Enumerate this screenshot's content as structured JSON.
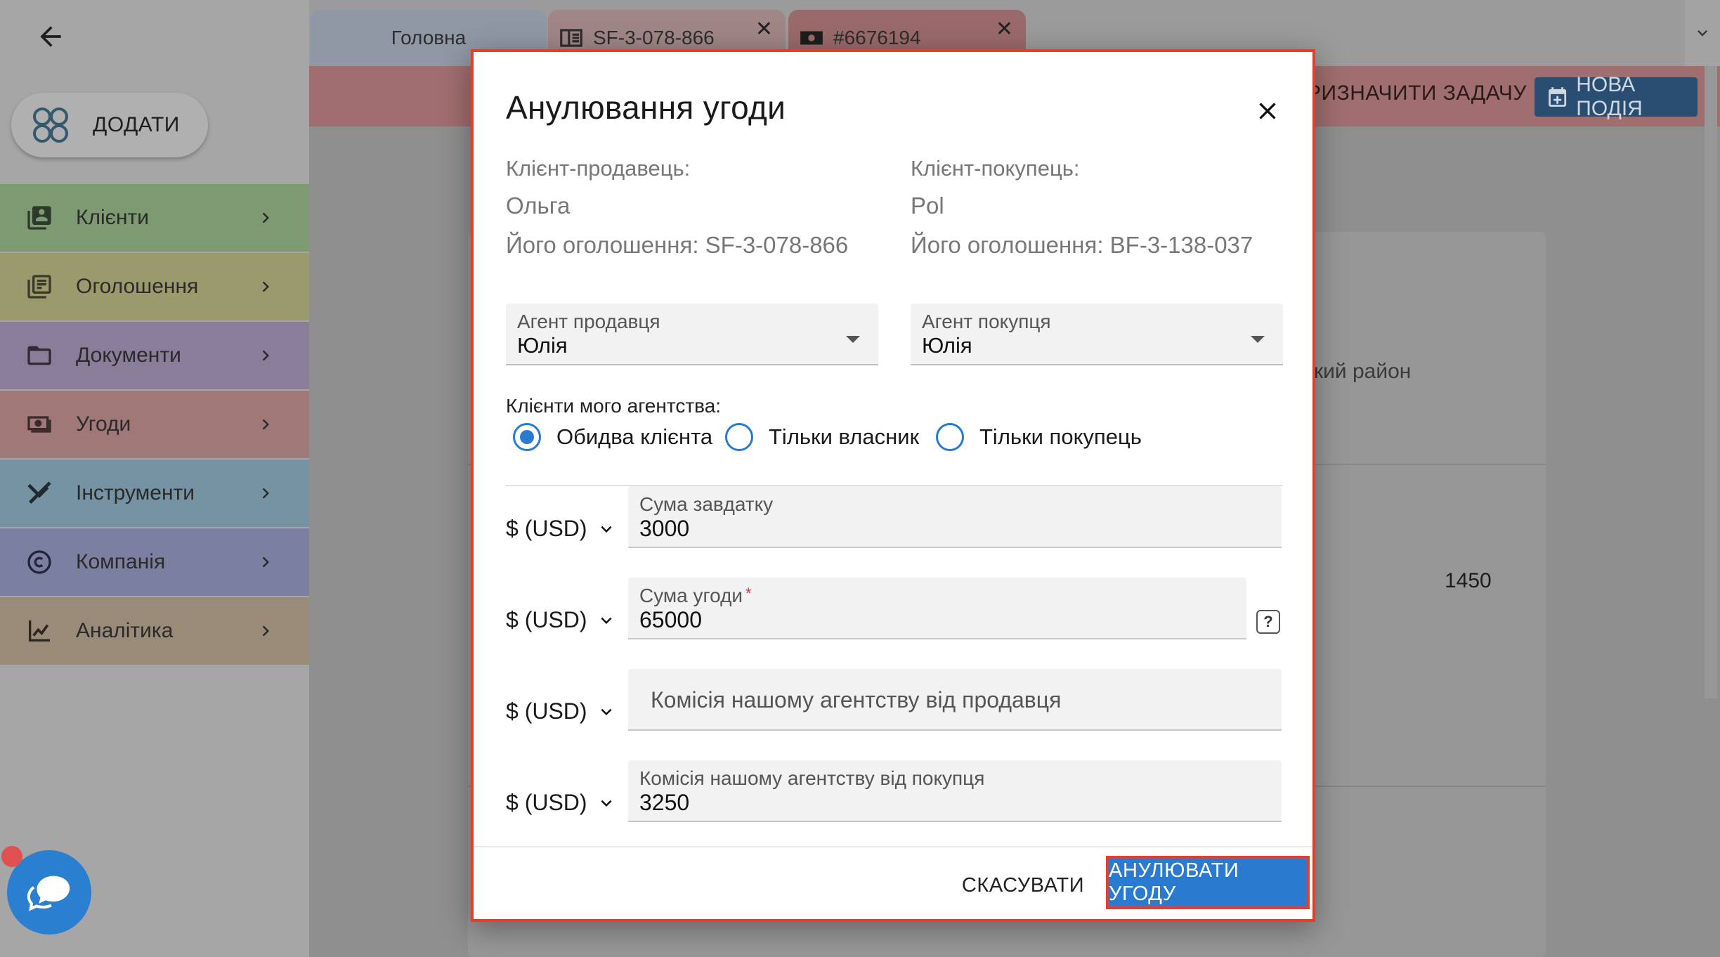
{
  "sidebar": {
    "add_label": "ДОДАТИ",
    "items": [
      {
        "label": "Клієнти",
        "color": "#7d9a72",
        "icon": "contacts-icon"
      },
      {
        "label": "Оголошення",
        "color": "#9b9a6c",
        "icon": "listing-icon"
      },
      {
        "label": "Документи",
        "color": "#8a7d9a",
        "icon": "folder-icon"
      },
      {
        "label": "Угоди",
        "color": "#a07878",
        "icon": "deal-icon"
      },
      {
        "label": "Інструменти",
        "color": "#7593a2",
        "icon": "tools-icon"
      },
      {
        "label": "Компанія",
        "color": "#7c80a0",
        "icon": "copyright-icon"
      },
      {
        "label": "Аналітика",
        "color": "#9a8a78",
        "icon": "analytics-icon"
      }
    ]
  },
  "tabs": [
    {
      "label": "Головна"
    },
    {
      "label": "SF-3-078-866"
    },
    {
      "label": "#6676194"
    }
  ],
  "actionbar": {
    "assign_task": "РИЗНАЧИТИ ЗАДАЧУ",
    "new_event": "НОВА ПОДІЯ"
  },
  "background": {
    "district": "кий район",
    "value": "1450"
  },
  "dialog": {
    "title": "Анулювання угоди",
    "seller": {
      "label": "Клієнт-продавець:",
      "name": "Ольга",
      "listing": "Його оголошення: SF-3-078-866"
    },
    "buyer": {
      "label": "Клієнт-покупець:",
      "name": "Pol",
      "listing": "Його оголошення: BF-3-138-037"
    },
    "seller_agent": {
      "label": "Агент продавця",
      "value": "Юлія"
    },
    "buyer_agent": {
      "label": "Агент покупця",
      "value": "Юлія"
    },
    "clients_group_label": "Клієнти мого агентства:",
    "radios": [
      {
        "label": "Обидва клієнта",
        "checked": true
      },
      {
        "label": "Тільки власник",
        "checked": false
      },
      {
        "label": "Тільки покупець",
        "checked": false
      }
    ],
    "currency": "$ (USD)",
    "deposit": {
      "label": "Сума завдатку",
      "value": "3000"
    },
    "deal_sum": {
      "label": "Сума угоди",
      "required_mark": "*",
      "value": "65000"
    },
    "seller_commission": {
      "placeholder": "Комісія нашому агентству від продавця"
    },
    "buyer_commission": {
      "label": "Комісія нашому агентству від покупця",
      "value": "3250"
    },
    "cancel_label": "СКАСУВАТИ",
    "confirm_label": "АНУЛЮВАТИ УГОДУ"
  },
  "colors": {
    "accent": "#2a7bd0",
    "highlight_border": "#e2402c"
  }
}
